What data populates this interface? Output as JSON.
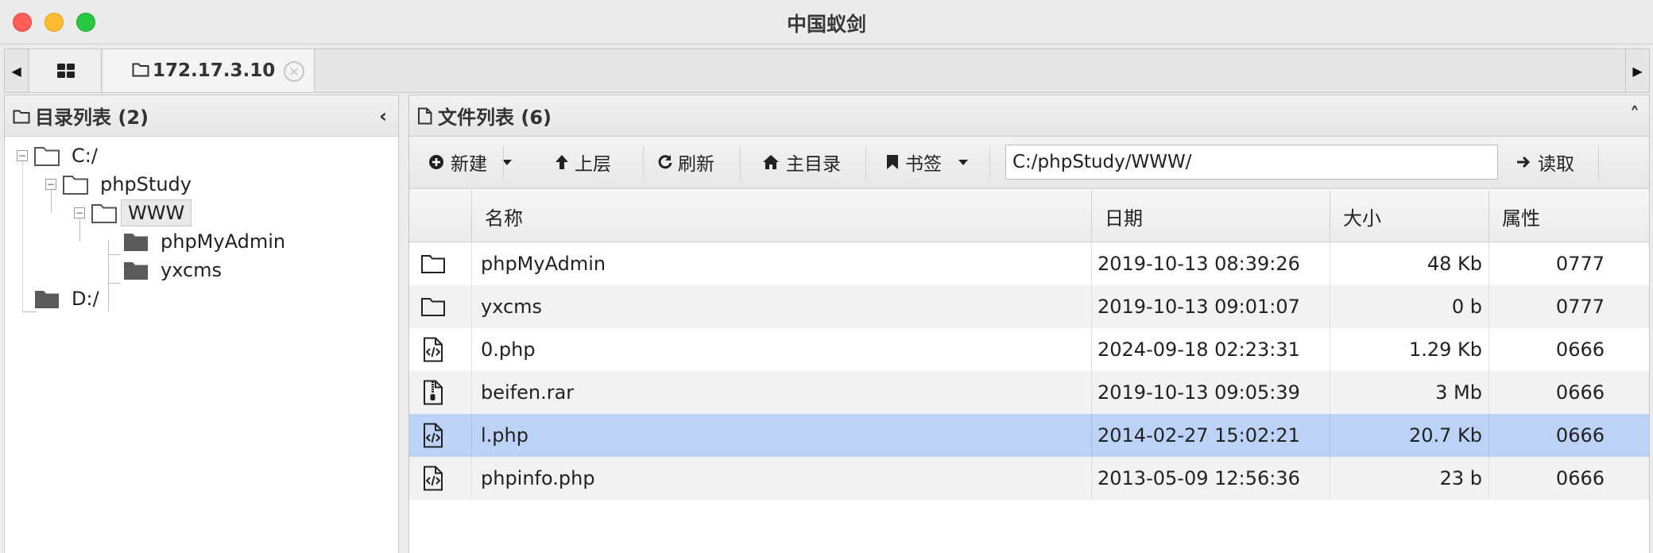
{
  "window": {
    "title": "中国蚁剑"
  },
  "tabs": {
    "home_icon": "grid-icon",
    "active_tab": {
      "icon": "folder-outline-icon",
      "label": "172.17.3.10",
      "close_icon": "close-circle-icon"
    }
  },
  "dir_panel": {
    "header": "目录列表 (2)",
    "tree": [
      {
        "label": "C:/",
        "depth": 0,
        "expanded": true,
        "icon": "folder-outline-icon"
      },
      {
        "label": "phpStudy",
        "depth": 1,
        "expanded": true,
        "icon": "folder-outline-icon"
      },
      {
        "label": "WWW",
        "depth": 2,
        "expanded": true,
        "selected": true,
        "icon": "folder-outline-icon"
      },
      {
        "label": "phpMyAdmin",
        "depth": 3,
        "icon": "folder-filled-icon"
      },
      {
        "label": "yxcms",
        "depth": 3,
        "icon": "folder-filled-icon"
      },
      {
        "label": "D:/",
        "depth": 0,
        "icon": "folder-filled-icon"
      }
    ]
  },
  "file_panel": {
    "header": "文件列表 (6)",
    "toolbar": {
      "new_label": "新建",
      "up_label": "上层",
      "refresh_label": "刷新",
      "home_label": "主目录",
      "bookmark_label": "书签",
      "path_value": "C:/phpStudy/WWW/",
      "read_label": "读取"
    },
    "columns": {
      "name": "名称",
      "date": "日期",
      "size": "大小",
      "attr": "属性"
    },
    "rows": [
      {
        "icon": "folder-outline-icon",
        "name": "phpMyAdmin",
        "date": "2019-10-13 08:39:26",
        "size": "48 Kb",
        "attr": "0777"
      },
      {
        "icon": "folder-outline-icon",
        "name": "yxcms",
        "date": "2019-10-13 09:01:07",
        "size": "0 b",
        "attr": "0777"
      },
      {
        "icon": "file-code-icon",
        "name": "0.php",
        "date": "2024-09-18 02:23:31",
        "size": "1.29 Kb",
        "attr": "0666"
      },
      {
        "icon": "file-zip-icon",
        "name": "beifen.rar",
        "date": "2019-10-13 09:05:39",
        "size": "3 Mb",
        "attr": "0666"
      },
      {
        "icon": "file-code-icon",
        "name": "l.php",
        "date": "2014-02-27 15:02:21",
        "size": "20.7 Kb",
        "attr": "0666",
        "selected": true
      },
      {
        "icon": "file-code-icon",
        "name": "phpinfo.php",
        "date": "2013-05-09 12:56:36",
        "size": "23 b",
        "attr": "0666"
      }
    ]
  },
  "colors": {
    "selected_row": "#bcd3f7",
    "close": "#ff5f57",
    "minimize": "#febc2e",
    "maximize": "#28c840"
  }
}
